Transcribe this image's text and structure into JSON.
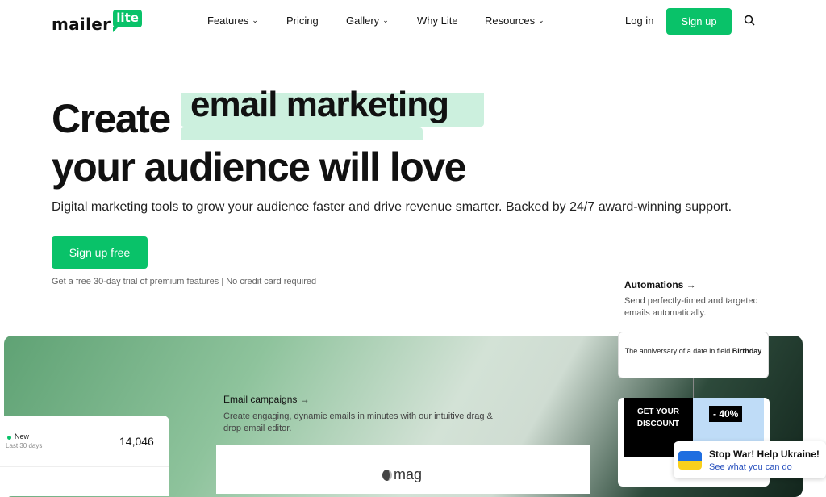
{
  "nav": {
    "logo_word": "mailer",
    "logo_badge": "lite",
    "items": [
      {
        "label": "Features",
        "dropdown": true
      },
      {
        "label": "Pricing",
        "dropdown": false
      },
      {
        "label": "Gallery",
        "dropdown": true
      },
      {
        "label": "Why Lite",
        "dropdown": false
      },
      {
        "label": "Resources",
        "dropdown": true
      }
    ],
    "login": "Log in",
    "signup": "Sign up",
    "search_icon": "search-icon"
  },
  "hero": {
    "line1_start": "Create",
    "highlight": "email marketing",
    "line2": "your audience will love",
    "subtitle": "Digital marketing tools to grow your audience faster and drive revenue smarter. Backed by 24/7 award-winning support.",
    "cta": "Sign up free",
    "note": "Get a free 30-day trial of premium features | No credit card required"
  },
  "automations": {
    "title": "Automations →",
    "desc": "Send perfectly-timed and targeted emails automatically.",
    "trigger_text": "The anniversary of a date in field",
    "trigger_field": "Birthday",
    "discount_title": "GET YOUR DISCOUNT",
    "discount_pct": "- 40%"
  },
  "stats": {
    "label": "New",
    "period": "Last 30 days",
    "value": "14,046"
  },
  "campaigns": {
    "title": "Email campaigns →",
    "desc": "Create engaging, dynamic emails in minutes with our intuitive drag & drop email editor.",
    "brand": "mag"
  },
  "banner": {
    "title": "Stop War! Help Ukraine!",
    "link": "See what you can do"
  },
  "colors": {
    "brand_green": "#09c269",
    "highlight": "#ccf0de",
    "link_blue": "#2a52be"
  }
}
